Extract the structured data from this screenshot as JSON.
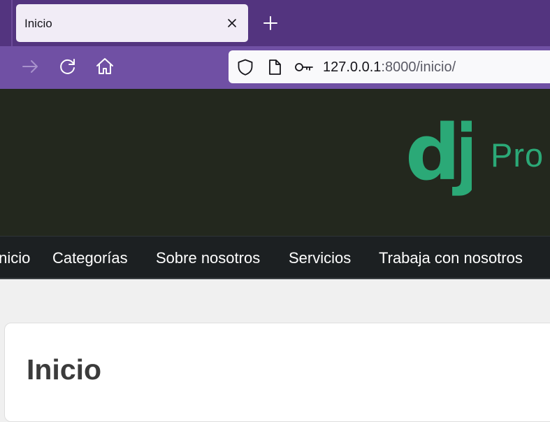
{
  "browser": {
    "tab": {
      "title": "Inicio"
    },
    "url": {
      "host": "127.0.0.1",
      "rest": ":8000/inicio/"
    }
  },
  "colors": {
    "tabstrip": "#53347f",
    "toolbar": "#7050a4",
    "hero_bg": "#23281e",
    "brand_green": "#2ba977",
    "menu_bg": "#1c2022"
  },
  "icons": {
    "tab_close": "close-icon",
    "new_tab": "plus-icon",
    "forward": "arrow-right-icon",
    "reload": "reload-icon",
    "home": "home-icon",
    "shield": "shield-icon",
    "page": "page-icon",
    "key": "key-icon"
  },
  "header": {
    "logo_text": "dj",
    "title": "Pro"
  },
  "menu": {
    "items": [
      "Inicio",
      "Categorías",
      "Sobre nosotros",
      "Servicios",
      "Trabaja con nosotros"
    ]
  },
  "main": {
    "title": "Inicio"
  }
}
